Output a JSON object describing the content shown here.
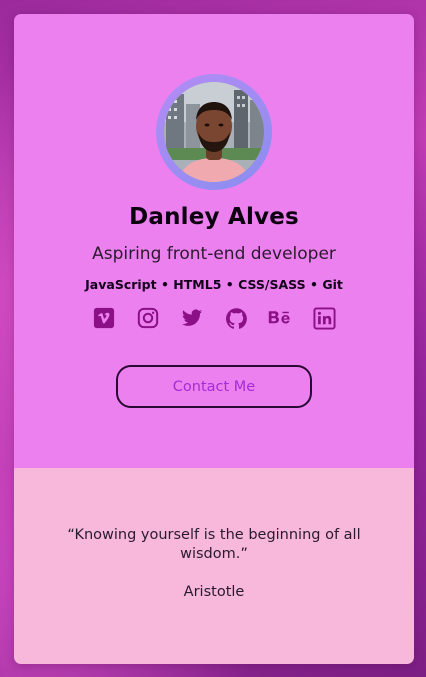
{
  "profile": {
    "name": "Danley Alves",
    "role": "Aspiring front-end developer",
    "skills": "JavaScript • HTML5 • CSS/SASS • Git"
  },
  "socials": [
    {
      "icon": "vimeo-icon"
    },
    {
      "icon": "instagram-icon"
    },
    {
      "icon": "twitter-icon"
    },
    {
      "icon": "github-icon"
    },
    {
      "icon": "behance-icon",
      "label": "Bē"
    },
    {
      "icon": "linkedin-icon"
    }
  ],
  "contact": {
    "label": "Contact Me"
  },
  "quote": {
    "text": "“Knowing yourself is the beginning of all wisdom.”",
    "author": "Aristotle"
  },
  "colors": {
    "card_top": "#ed80ef",
    "card_bottom": "#f7b8dc",
    "icon": "#8b0f86",
    "button_text": "#a52bd6",
    "avatar_ring": "#9a8df2"
  }
}
